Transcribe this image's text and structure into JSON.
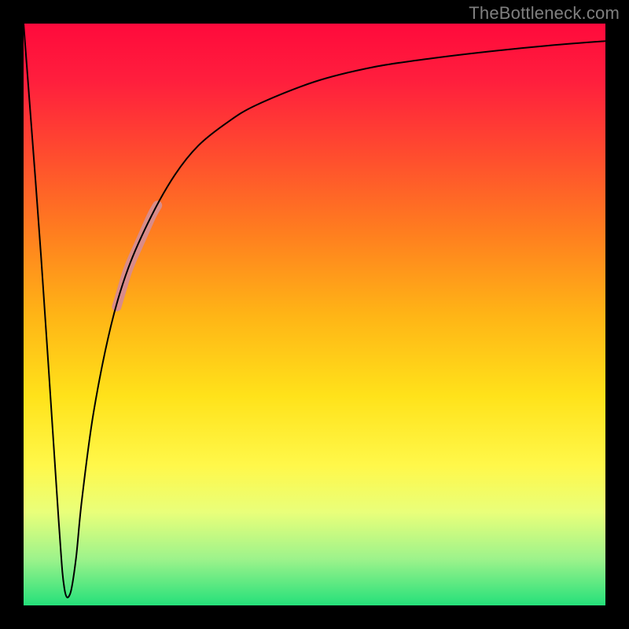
{
  "watermark": "TheBottleneck.com",
  "chart_data": {
    "type": "line",
    "title": "",
    "xlabel": "",
    "ylabel": "",
    "xlim": [
      0,
      100
    ],
    "ylim": [
      0,
      100
    ],
    "grid": false,
    "series": [
      {
        "name": "curve",
        "x": [
          0,
          3,
          6,
          7,
          8,
          9,
          10,
          12,
          15,
          18,
          22,
          26,
          30,
          35,
          40,
          50,
          60,
          70,
          80,
          90,
          100
        ],
        "values": [
          100,
          60,
          15,
          3,
          2,
          8,
          18,
          33,
          48,
          58,
          67,
          74,
          79,
          83,
          86,
          90,
          92.5,
          94,
          95.2,
          96.2,
          97
        ]
      }
    ],
    "highlight_segment": {
      "series": "curve",
      "x_start": 16,
      "x_end": 23,
      "color": "#d98c89",
      "width": 12
    }
  }
}
